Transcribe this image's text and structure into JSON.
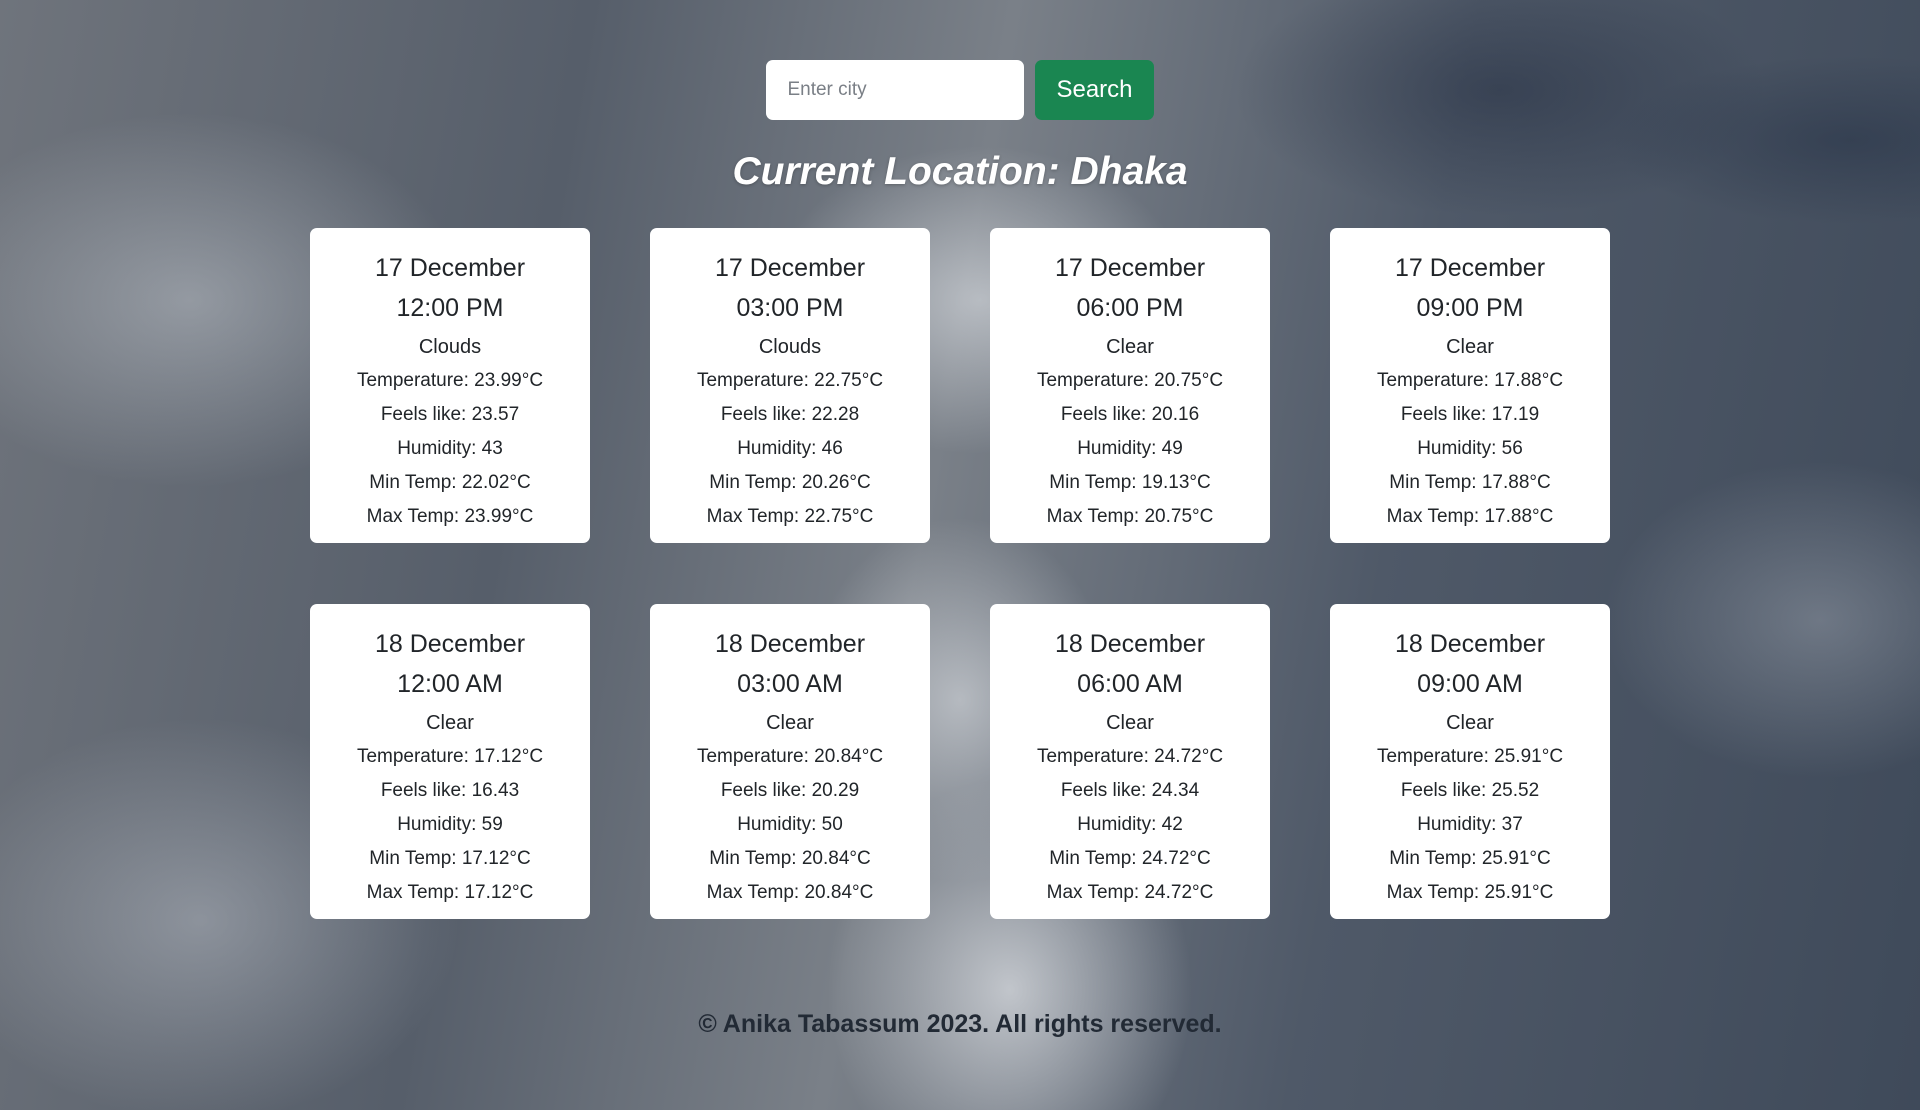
{
  "search": {
    "placeholder": "Enter city",
    "button_label": "Search"
  },
  "location": {
    "title": "Current Location: Dhaka"
  },
  "forecast": [
    {
      "date": "17 December",
      "time": "12:00 PM",
      "condition": "Clouds",
      "temperature": "Temperature: 23.99°C",
      "feels_like": "Feels like: 23.57",
      "humidity": "Humidity: 43",
      "min_temp": "Min Temp: 22.02°C",
      "max_temp": "Max Temp: 23.99°C"
    },
    {
      "date": "17 December",
      "time": "03:00 PM",
      "condition": "Clouds",
      "temperature": "Temperature: 22.75°C",
      "feels_like": "Feels like: 22.28",
      "humidity": "Humidity: 46",
      "min_temp": "Min Temp: 20.26°C",
      "max_temp": "Max Temp: 22.75°C"
    },
    {
      "date": "17 December",
      "time": "06:00 PM",
      "condition": "Clear",
      "temperature": "Temperature: 20.75°C",
      "feels_like": "Feels like: 20.16",
      "humidity": "Humidity: 49",
      "min_temp": "Min Temp: 19.13°C",
      "max_temp": "Max Temp: 20.75°C"
    },
    {
      "date": "17 December",
      "time": "09:00 PM",
      "condition": "Clear",
      "temperature": "Temperature: 17.88°C",
      "feels_like": "Feels like: 17.19",
      "humidity": "Humidity: 56",
      "min_temp": "Min Temp: 17.88°C",
      "max_temp": "Max Temp: 17.88°C"
    },
    {
      "date": "18 December",
      "time": "12:00 AM",
      "condition": "Clear",
      "temperature": "Temperature: 17.12°C",
      "feels_like": "Feels like: 16.43",
      "humidity": "Humidity: 59",
      "min_temp": "Min Temp: 17.12°C",
      "max_temp": "Max Temp: 17.12°C"
    },
    {
      "date": "18 December",
      "time": "03:00 AM",
      "condition": "Clear",
      "temperature": "Temperature: 20.84°C",
      "feels_like": "Feels like: 20.29",
      "humidity": "Humidity: 50",
      "min_temp": "Min Temp: 20.84°C",
      "max_temp": "Max Temp: 20.84°C"
    },
    {
      "date": "18 December",
      "time": "06:00 AM",
      "condition": "Clear",
      "temperature": "Temperature: 24.72°C",
      "feels_like": "Feels like: 24.34",
      "humidity": "Humidity: 42",
      "min_temp": "Min Temp: 24.72°C",
      "max_temp": "Max Temp: 24.72°C"
    },
    {
      "date": "18 December",
      "time": "09:00 AM",
      "condition": "Clear",
      "temperature": "Temperature: 25.91°C",
      "feels_like": "Feels like: 25.52",
      "humidity": "Humidity: 37",
      "min_temp": "Min Temp: 25.91°C",
      "max_temp": "Max Temp: 25.91°C"
    }
  ],
  "footer": {
    "text": "© Anika Tabassum 2023. All rights reserved."
  },
  "colors": {
    "search_button": "#1a8651",
    "card_background": "#ffffff",
    "title_text": "#ffffff"
  }
}
